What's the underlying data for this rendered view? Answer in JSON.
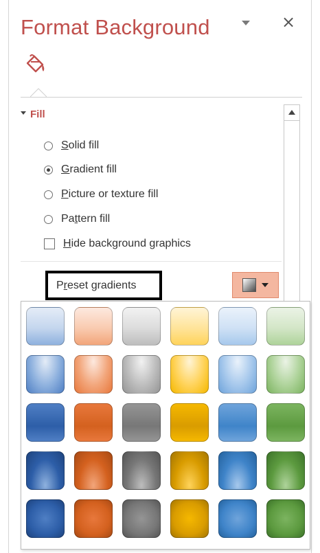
{
  "pane": {
    "title": "Format Background",
    "tab_icon": "paint-bucket-icon",
    "close_glyph": "×"
  },
  "fill": {
    "section_label": "Fill",
    "options": [
      {
        "pre": "",
        "key": "S",
        "post": "olid fill",
        "selected": false
      },
      {
        "pre": "",
        "key": "G",
        "post": "radient fill",
        "selected": true
      },
      {
        "pre": "",
        "key": "P",
        "post": "icture or texture fill",
        "selected": false
      },
      {
        "pre": "Pa",
        "key": "t",
        "post": "tern fill",
        "selected": false
      }
    ],
    "hide_graphics": {
      "pre": "",
      "key": "H",
      "post": "ide background graphics",
      "checked": false
    },
    "preset": {
      "pre": "P",
      "key": "r",
      "post": "eset gradients"
    }
  },
  "colors": {
    "accent": "#c0504d",
    "preset_button": "#f4b7a0"
  },
  "gallery": {
    "columns": [
      "blue",
      "orange",
      "gray",
      "gold",
      "sky-blue",
      "green"
    ],
    "rows": [
      [
        "light gradient - accent 1",
        "light gradient - accent 2",
        "light gradient - accent 3",
        "light gradient - accent 4",
        "light gradient - accent 5",
        "light gradient - accent 6"
      ],
      [
        "top spotlight - accent 1",
        "top spotlight - accent 2",
        "top spotlight - accent 3",
        "top spotlight - accent 4",
        "top spotlight - accent 5",
        "top spotlight - accent 6"
      ],
      [
        "medium gradient - accent 1",
        "medium gradient - accent 2",
        "medium gradient - accent 3",
        "medium gradient - accent 4",
        "medium gradient - accent 5",
        "medium gradient - accent 6"
      ],
      [
        "bottom spotlight - accent 1",
        "bottom spotlight - accent 2",
        "bottom spotlight - accent 3",
        "bottom spotlight - accent 4",
        "bottom spotlight - accent 5",
        "bottom spotlight - accent 6"
      ],
      [
        "radial gradient - accent 1",
        "radial gradient - accent 2",
        "radial gradient - accent 3",
        "radial gradient - accent 4",
        "radial gradient - accent 5",
        "radial gradient - accent 6"
      ]
    ],
    "palette": {
      "blue": [
        "#e4ecf7",
        "#c4d6ee",
        "#8eb1de",
        "#4f7fc4",
        "#2d5ea8",
        "#1e447f"
      ],
      "orange": [
        "#fde9df",
        "#f9cbb0",
        "#f2a57a",
        "#e8783c",
        "#d4611f",
        "#a84a14"
      ],
      "gray": [
        "#f2f2f2",
        "#dcdcdc",
        "#bdbdbd",
        "#959595",
        "#777777",
        "#555555"
      ],
      "gold": [
        "#fff4d6",
        "#ffe49a",
        "#ffd35a",
        "#f5b800",
        "#d99c00",
        "#a67700"
      ],
      "sky-blue": [
        "#eaf2fb",
        "#cfe1f5",
        "#a6c8ec",
        "#6fa4db",
        "#3f84c9",
        "#25639f"
      ],
      "green": [
        "#ebf3e6",
        "#d3e6c7",
        "#aed39a",
        "#7cb460",
        "#5c9a3f",
        "#3d742a"
      ]
    }
  }
}
